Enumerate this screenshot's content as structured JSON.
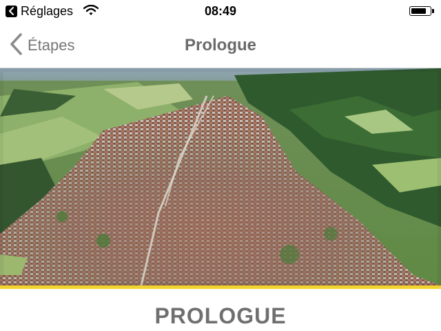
{
  "status_bar": {
    "back_app_label": "Réglages",
    "time": "08:49",
    "battery_level": 0.8
  },
  "nav": {
    "back_label": "Étapes",
    "title": "Prologue"
  },
  "hero": {
    "accent_color": "#f1d52e"
  },
  "stage": {
    "heading": "PROLOGUE"
  }
}
